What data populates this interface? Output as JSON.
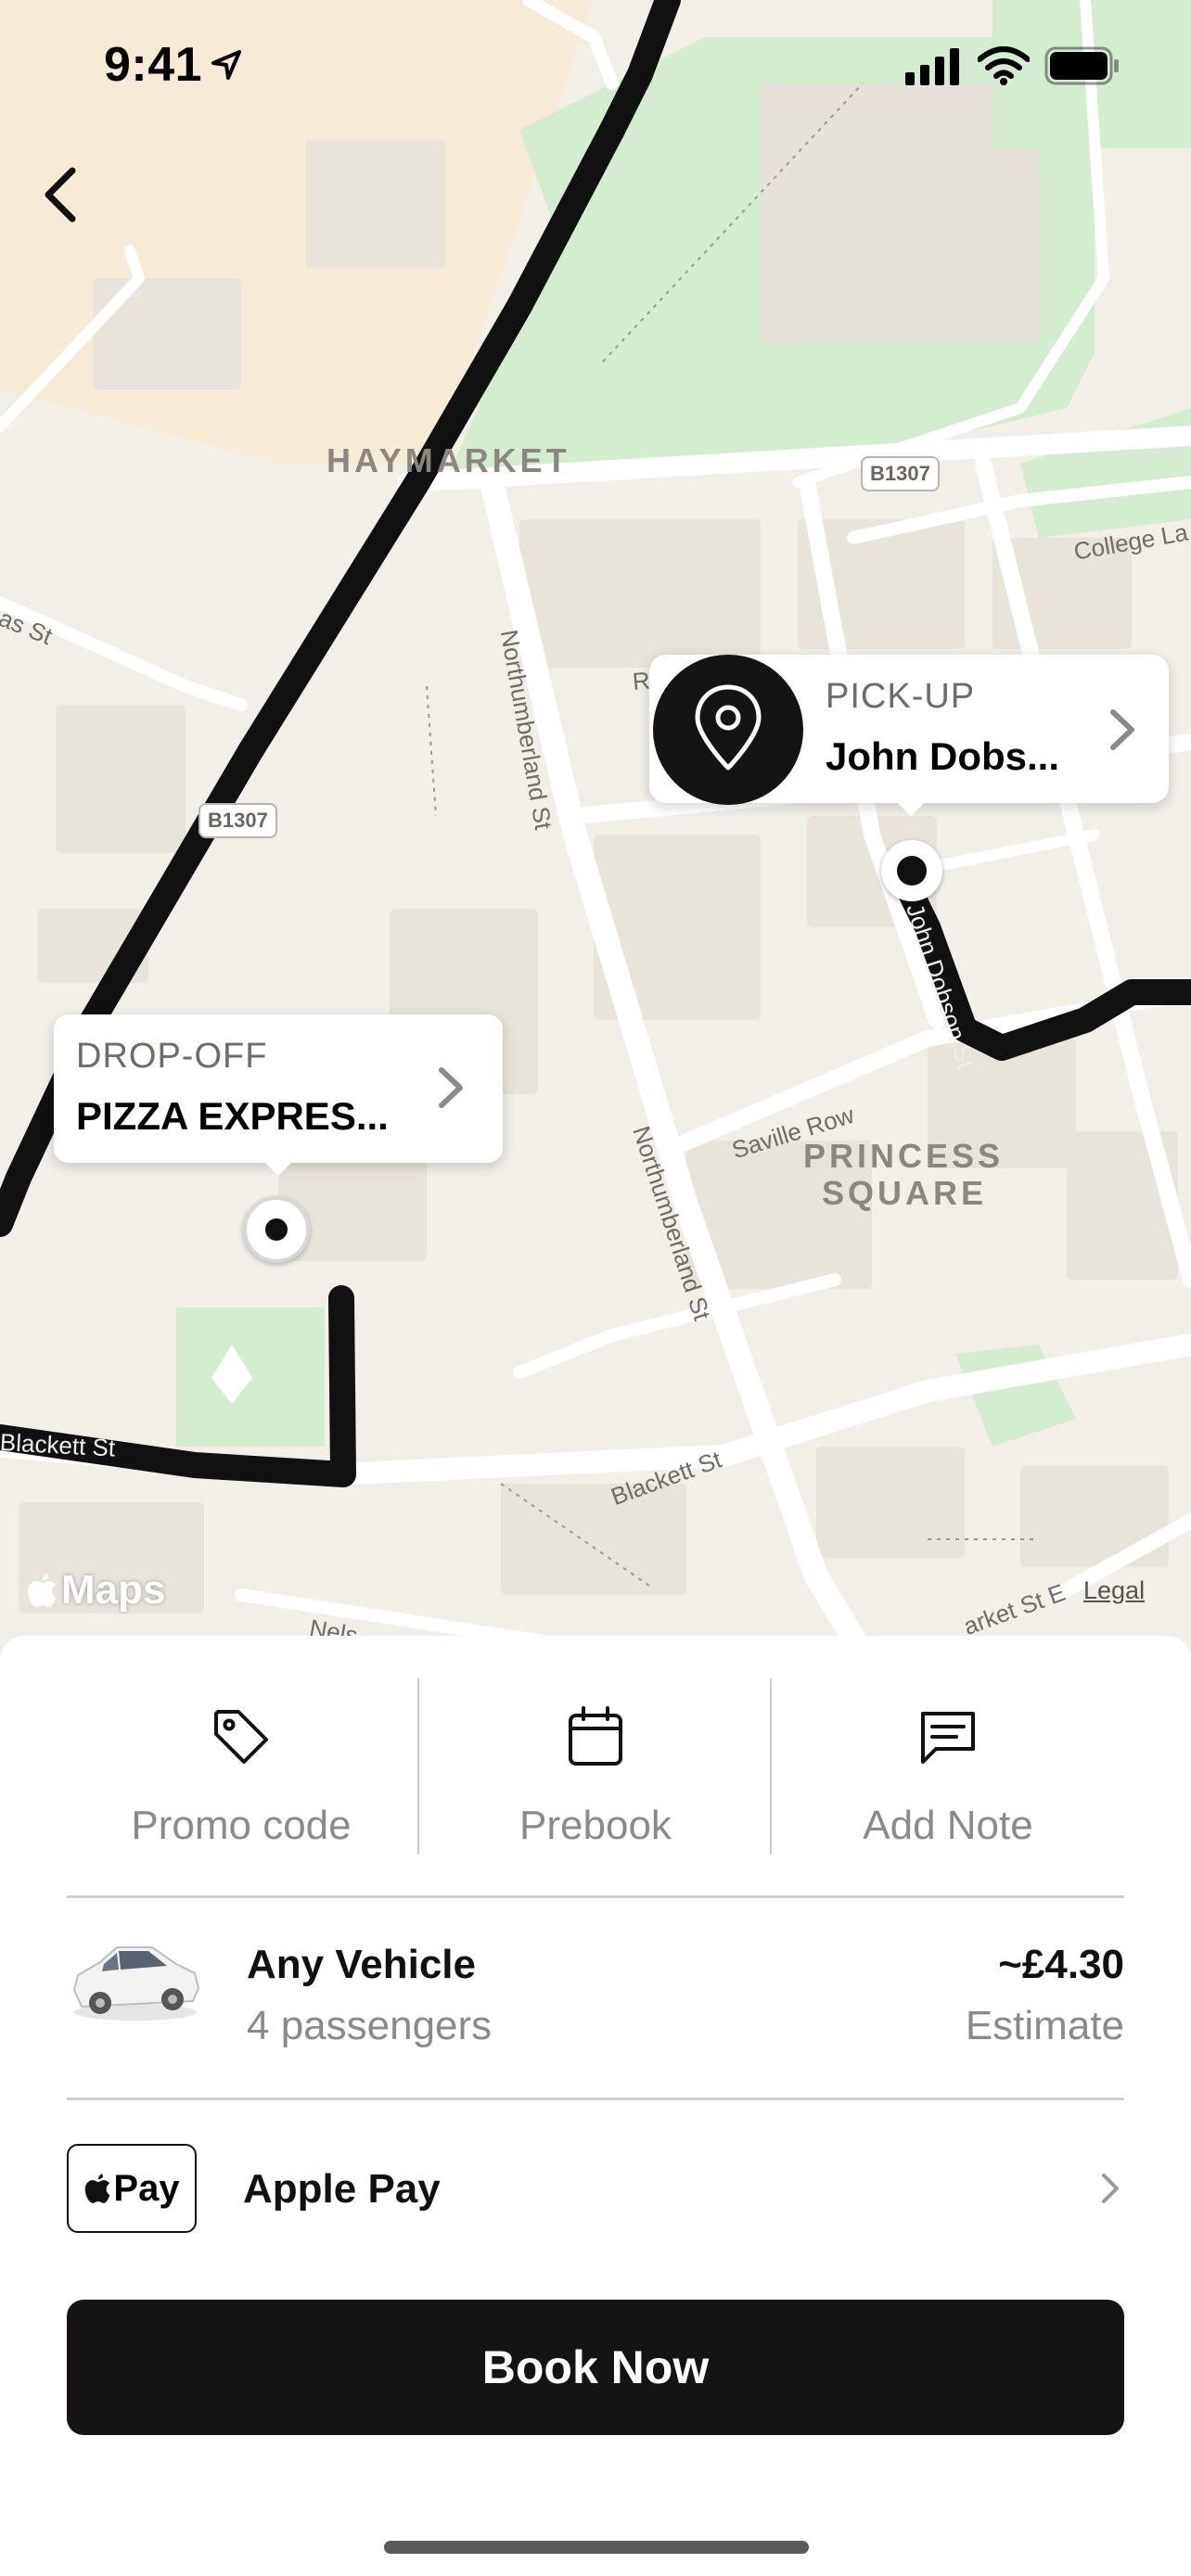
{
  "status_bar": {
    "time": "9:41"
  },
  "map": {
    "area_labels": [
      "HAYMARKET",
      "PRINCESS",
      "SQUARE"
    ],
    "road_badges": [
      "B1307",
      "B1307"
    ],
    "streets": [
      "Northumberland St",
      "Northumberland St",
      "Saville Row",
      "John Dobson St",
      "Blackett St",
      "Blackett St",
      "College La",
      "Ridl",
      "as St",
      "arket St E",
      "Nels"
    ],
    "attribution": "Maps",
    "legal": "Legal"
  },
  "pickup": {
    "label": "PICK-UP",
    "value": "John Dobs..."
  },
  "dropoff": {
    "label": "DROP-OFF",
    "value": "PIZZA EXPRES..."
  },
  "actions": [
    {
      "label": "Promo code",
      "icon": "tag-icon"
    },
    {
      "label": "Prebook",
      "icon": "calendar-icon"
    },
    {
      "label": "Add Note",
      "icon": "message-icon"
    }
  ],
  "vehicle": {
    "name": "Any Vehicle",
    "passengers": "4 passengers",
    "price": "~£4.30",
    "price_note": "Estimate"
  },
  "payment": {
    "badge": "Pay",
    "label": "Apple Pay"
  },
  "book_button": "Book Now",
  "colors": {
    "map_bg": "#f2efe9",
    "park": "#d4ecd0",
    "route": "#111111",
    "button": "#151313",
    "muted_text": "#8a8a8a"
  }
}
